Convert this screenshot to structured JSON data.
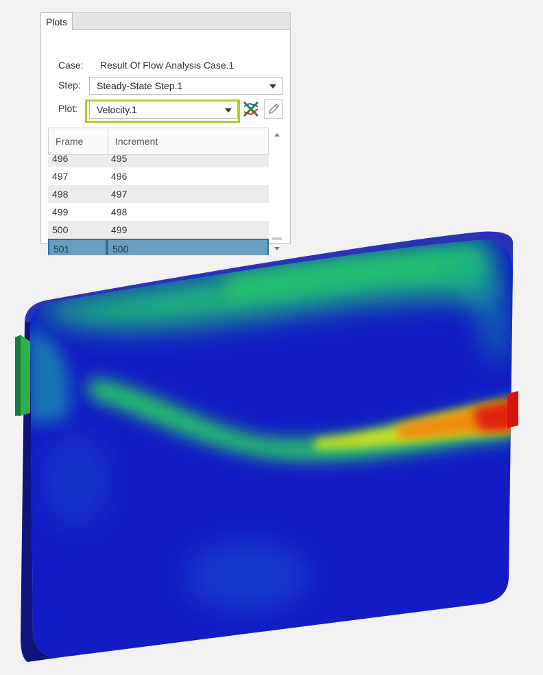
{
  "plots_panel": {
    "tab_label": "Plots",
    "case_label": "Case:",
    "case_value": "Result Of Flow Analysis Case.1",
    "step_label": "Step:",
    "step_value": "Steady-State Step.1",
    "plot_label": "Plot:",
    "plot_value": "Velocity.1",
    "highlight_color": "#b4cc2c",
    "icons": [
      "plot-style-icon",
      "pencil-edit-icon",
      "chevron-down-icon",
      "scroll-up-icon",
      "scroll-down-icon"
    ],
    "table": {
      "headers": [
        "Frame",
        "Increment"
      ],
      "rows": [
        {
          "frame": "496",
          "increment": "495"
        },
        {
          "frame": "497",
          "increment": "496"
        },
        {
          "frame": "498",
          "increment": "497"
        },
        {
          "frame": "499",
          "increment": "498"
        },
        {
          "frame": "500",
          "increment": "499"
        },
        {
          "frame": "501",
          "increment": "500"
        }
      ],
      "selected_frame": "501"
    }
  },
  "viewport": {
    "description_colors": {
      "low": "#1414c8",
      "mid": "#1cc37a",
      "high": "#e01a0a"
    }
  }
}
